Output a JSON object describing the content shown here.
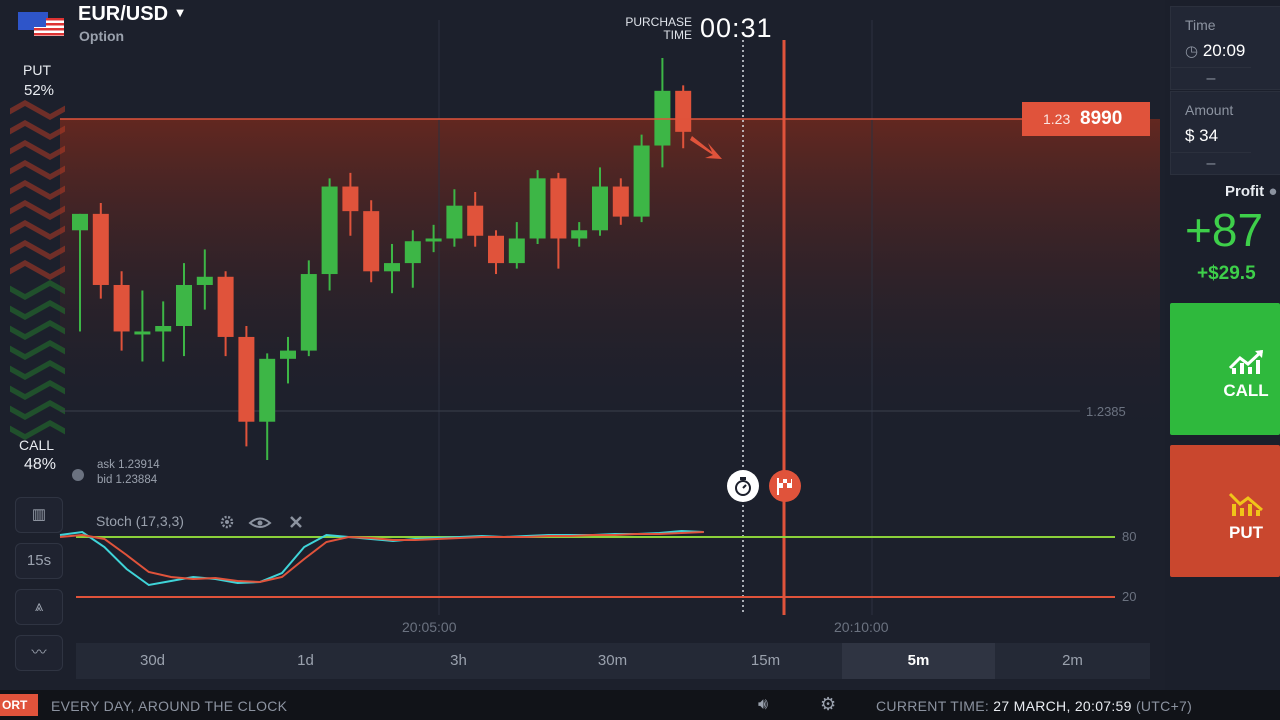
{
  "asset": {
    "name": "EUR/USD",
    "type": "Option"
  },
  "sentiment": {
    "put_label": "PUT",
    "put_pct": "52%",
    "call_label": "CALL",
    "call_pct": "48%"
  },
  "purchase": {
    "label_line1": "PURCHASE",
    "label_line2": "TIME",
    "countdown": "00:31"
  },
  "price_tag": {
    "prefix": "1.23",
    "main": "8990"
  },
  "price_level_label": "1.2385",
  "quote": {
    "ask": "ask 1.23914",
    "bid": "bid 1.23884"
  },
  "indicator": {
    "label": "Stoch (17,3,3)",
    "level_high": "80",
    "level_low": "20"
  },
  "time_axis": [
    "20:05:00",
    "20:10:00"
  ],
  "tools": {
    "interval": "15s"
  },
  "timeframes": [
    {
      "label": "30d"
    },
    {
      "label": "1d"
    },
    {
      "label": "3h"
    },
    {
      "label": "30m"
    },
    {
      "label": "15m"
    },
    {
      "label": "5m",
      "active": true
    },
    {
      "label": "2m"
    }
  ],
  "right_panel": {
    "time_label": "Time",
    "time_value": "20:09",
    "amount_label": "Amount",
    "amount_value": "$ 34",
    "minus_symbol": "–",
    "profit_label": "Profit",
    "profit_pct": "+87",
    "profit_amount": "+$29.5",
    "call_button": "CALL",
    "put_button": "PUT"
  },
  "footer": {
    "tag": "ORT",
    "slogan": "EVERY DAY, AROUND THE CLOCK",
    "current_time_label": "CURRENT TIME:",
    "current_time_value": "27 MARCH, 20:07:59",
    "timezone": "(UTC+7)"
  },
  "colors": {
    "bull": "#3db646",
    "bear": "#e0533b",
    "accent_green": "#2fb93d",
    "accent_red": "#c9472e"
  },
  "chart_data": {
    "type": "candlestick",
    "candles": [
      {
        "o": 1.23882,
        "h": 1.23888,
        "l": 1.23845,
        "c": 1.23888
      },
      {
        "o": 1.23888,
        "h": 1.23892,
        "l": 1.23857,
        "c": 1.23862
      },
      {
        "o": 1.23862,
        "h": 1.23867,
        "l": 1.23838,
        "c": 1.23845
      },
      {
        "o": 1.23845,
        "h": 1.2386,
        "l": 1.23834,
        "c": 1.23845
      },
      {
        "o": 1.23845,
        "h": 1.23856,
        "l": 1.23834,
        "c": 1.23847
      },
      {
        "o": 1.23847,
        "h": 1.2387,
        "l": 1.23836,
        "c": 1.23862
      },
      {
        "o": 1.23862,
        "h": 1.23875,
        "l": 1.23853,
        "c": 1.23865
      },
      {
        "o": 1.23865,
        "h": 1.23867,
        "l": 1.23836,
        "c": 1.23843
      },
      {
        "o": 1.23843,
        "h": 1.23847,
        "l": 1.23803,
        "c": 1.23812
      },
      {
        "o": 1.23812,
        "h": 1.23837,
        "l": 1.23798,
        "c": 1.23835
      },
      {
        "o": 1.23835,
        "h": 1.23843,
        "l": 1.23826,
        "c": 1.23838
      },
      {
        "o": 1.23838,
        "h": 1.23871,
        "l": 1.23836,
        "c": 1.23866
      },
      {
        "o": 1.23866,
        "h": 1.23901,
        "l": 1.2386,
        "c": 1.23898
      },
      {
        "o": 1.23898,
        "h": 1.23903,
        "l": 1.2388,
        "c": 1.23889
      },
      {
        "o": 1.23889,
        "h": 1.23893,
        "l": 1.23863,
        "c": 1.23867
      },
      {
        "o": 1.23867,
        "h": 1.23877,
        "l": 1.23859,
        "c": 1.2387
      },
      {
        "o": 1.2387,
        "h": 1.23882,
        "l": 1.23861,
        "c": 1.23878
      },
      {
        "o": 1.23878,
        "h": 1.23884,
        "l": 1.23874,
        "c": 1.23879
      },
      {
        "o": 1.23879,
        "h": 1.23897,
        "l": 1.23876,
        "c": 1.23891
      },
      {
        "o": 1.23891,
        "h": 1.23896,
        "l": 1.23876,
        "c": 1.2388
      },
      {
        "o": 1.2388,
        "h": 1.23882,
        "l": 1.23866,
        "c": 1.2387
      },
      {
        "o": 1.2387,
        "h": 1.23885,
        "l": 1.23868,
        "c": 1.23879
      },
      {
        "o": 1.23879,
        "h": 1.23904,
        "l": 1.23877,
        "c": 1.23901
      },
      {
        "o": 1.23901,
        "h": 1.23903,
        "l": 1.23868,
        "c": 1.23879
      },
      {
        "o": 1.23879,
        "h": 1.23885,
        "l": 1.23876,
        "c": 1.23882
      },
      {
        "o": 1.23882,
        "h": 1.23905,
        "l": 1.2388,
        "c": 1.23898
      },
      {
        "o": 1.23898,
        "h": 1.23901,
        "l": 1.23884,
        "c": 1.23887
      },
      {
        "o": 1.23887,
        "h": 1.23917,
        "l": 1.23885,
        "c": 1.23913
      },
      {
        "o": 1.23913,
        "h": 1.23945,
        "l": 1.23905,
        "c": 1.23933
      },
      {
        "o": 1.23933,
        "h": 1.23935,
        "l": 1.23912,
        "c": 1.23918
      }
    ],
    "price_level": 1.23899,
    "grid_price": 1.2385,
    "stochastic": {
      "k": [
        82,
        85,
        70,
        48,
        32,
        36,
        40,
        38,
        34,
        35,
        44,
        70,
        82,
        80,
        78,
        76,
        78,
        79,
        80,
        81,
        80,
        81,
        82,
        82,
        82,
        83,
        83,
        84,
        86,
        85
      ],
      "d": [
        80,
        82,
        78,
        62,
        45,
        40,
        38,
        39,
        36,
        35,
        40,
        58,
        75,
        80,
        79,
        77,
        77,
        78,
        79,
        80,
        80,
        80,
        81,
        81,
        82,
        82,
        83,
        83,
        84,
        85
      ]
    }
  }
}
